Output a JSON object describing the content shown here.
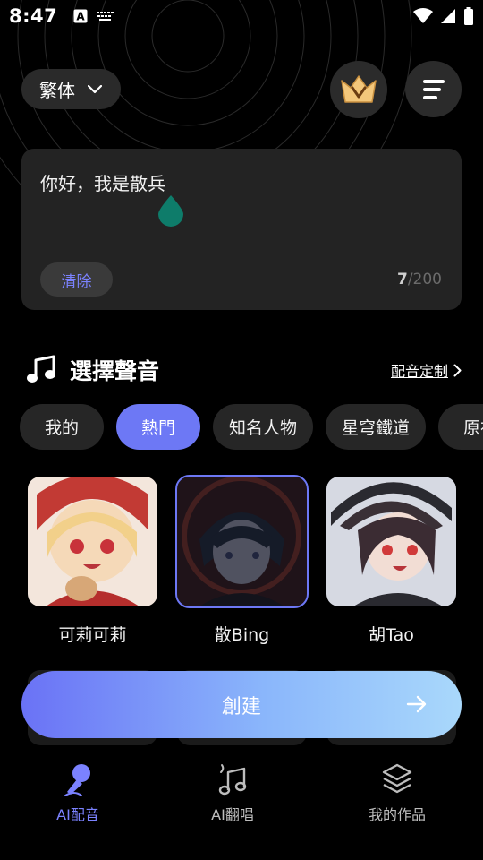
{
  "status_bar": {
    "time": "8:47",
    "icons": [
      "font-a-icon",
      "keyboard-icon",
      "wifi-icon",
      "signal-icon",
      "battery-icon"
    ]
  },
  "header": {
    "language_label": "繁体",
    "vip_icon": "crown-v-icon",
    "menu_icon": "menu-icon"
  },
  "text_input": {
    "content": "你好，我是散兵",
    "clear_label": "清除",
    "count_current": "7",
    "count_max": "/200"
  },
  "voice_section": {
    "title": "選擇聲音",
    "custom_link": "配音定制",
    "categories": [
      "我的",
      "熱門",
      "知名人物",
      "星穹鐵道",
      "原神"
    ],
    "active_category": 1,
    "voices": [
      {
        "name": "可莉可莉",
        "selected": false
      },
      {
        "name": "散Bing",
        "selected": true
      },
      {
        "name": "胡Tao",
        "selected": false
      }
    ]
  },
  "create_button": {
    "label": "創建"
  },
  "bottom_nav": {
    "items": [
      {
        "label": "AI配音",
        "icon": "microphone-icon",
        "active": true
      },
      {
        "label": "AI翻唱",
        "icon": "music-note-icon",
        "active": false
      },
      {
        "label": "我的作品",
        "icon": "layers-icon",
        "active": false
      }
    ]
  },
  "colors": {
    "accent": "#6d78f5",
    "accent_text": "#7b82ff",
    "card_bg": "#232323",
    "chip_bg": "#262626",
    "background": "#000000"
  }
}
